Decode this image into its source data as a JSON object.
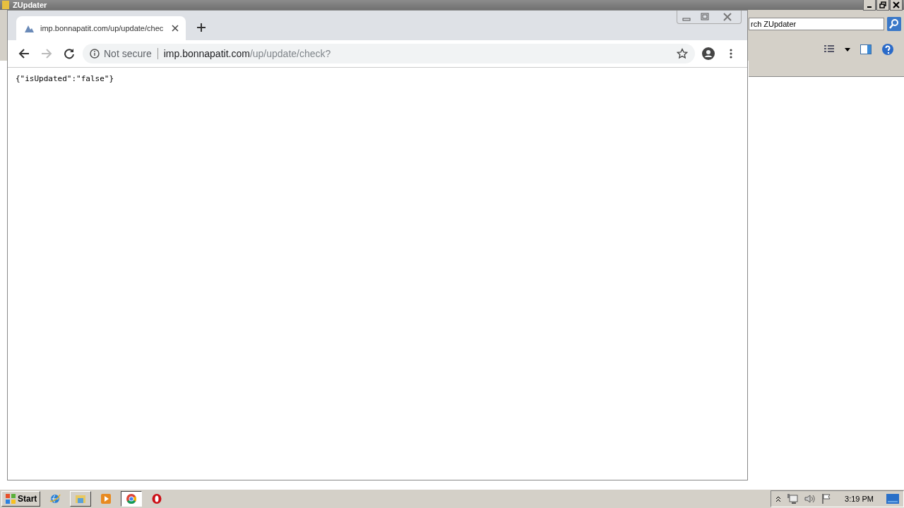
{
  "background_window": {
    "title": "ZUpdater",
    "search": {
      "value": "rch ZUpdater"
    }
  },
  "browser": {
    "tab": {
      "title": "imp.bonnapatit.com/up/update/chec",
      "selected": true
    },
    "address": {
      "security": "Not secure",
      "host": "imp.bonnapatit.com",
      "path": "/up/update/check?"
    },
    "content": "{\"isUpdated\":\"false\"}"
  },
  "taskbar": {
    "start": "Start",
    "apps": [
      {
        "kind": "ie",
        "running": false,
        "selected": false
      },
      {
        "kind": "folder",
        "running": true,
        "selected": false
      },
      {
        "kind": "media",
        "running": false,
        "selected": false
      },
      {
        "kind": "chrome",
        "running": true,
        "selected": true
      },
      {
        "kind": "opera",
        "running": false,
        "selected": false
      }
    ],
    "clock": "3:19 PM"
  }
}
